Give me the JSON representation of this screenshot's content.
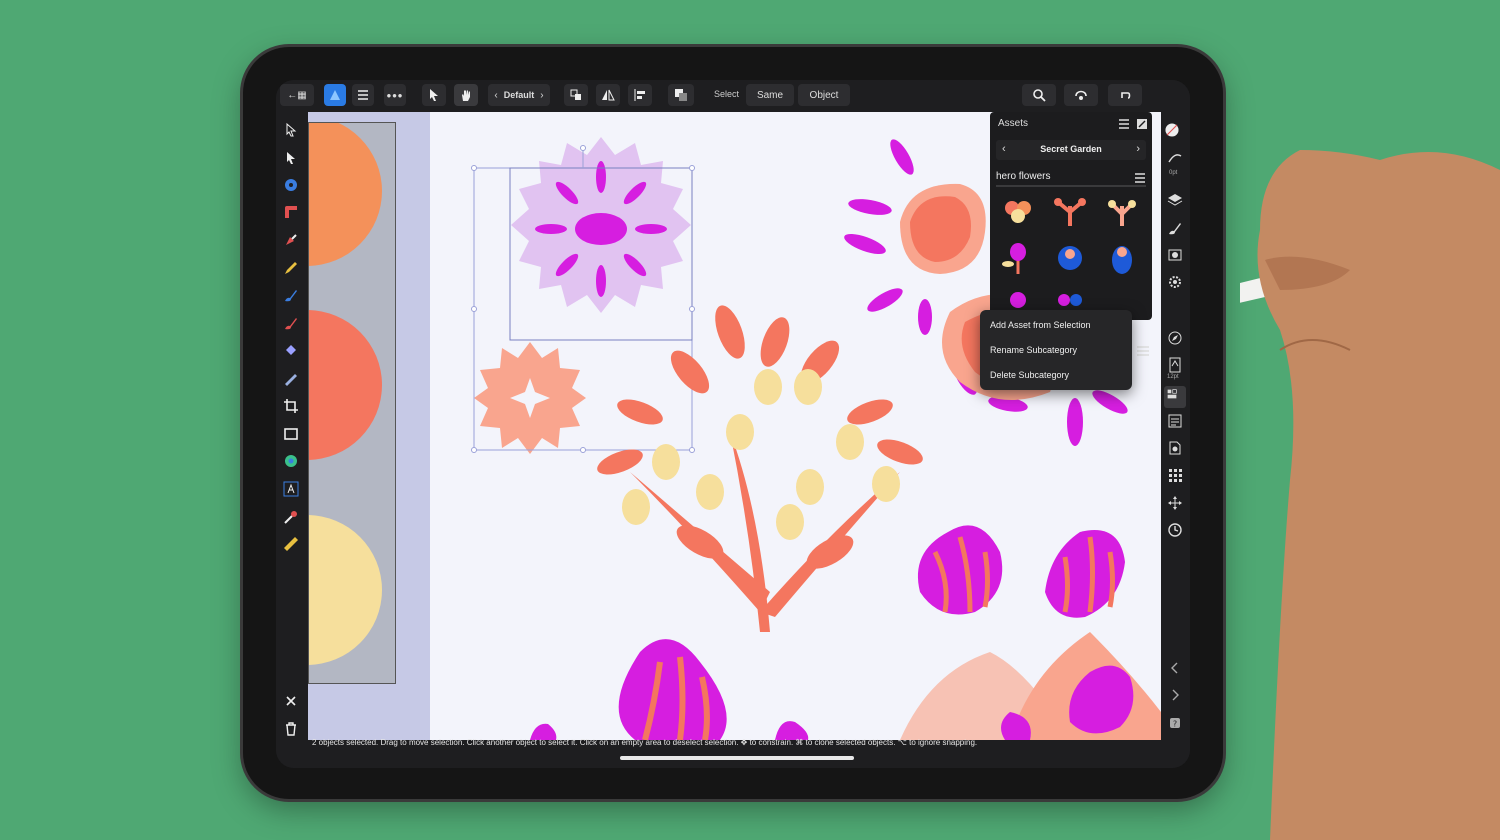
{
  "toolbar": {
    "persona_style": "Default",
    "select_label": "Select",
    "same_label": "Same",
    "object_label": "Object"
  },
  "assets_panel": {
    "title": "Assets",
    "category": "Secret Garden",
    "subcategory": "hero flowers",
    "asset_count_visible": 8
  },
  "context_menu": {
    "items": [
      "Add Asset from Selection",
      "Rename Subcategory",
      "Delete Subcategory"
    ]
  },
  "right_panel": {
    "stroke_size": "0pt",
    "font_size": "12pt"
  },
  "status_bar": {
    "text": "2 objects selected. Drag to move selection. Click another object to select it. Click on an empty area to deselect selection. ✥ to constrain. ⌘ to clone selected objects. ⌥ to ignore snapping."
  },
  "colors": {
    "background": "#4fa873",
    "accent": "#2a7be4",
    "coral": "#f4765f",
    "magenta": "#d61ee0",
    "lavender": "#e1c3f1",
    "pale_yellow": "#f6df9c"
  }
}
